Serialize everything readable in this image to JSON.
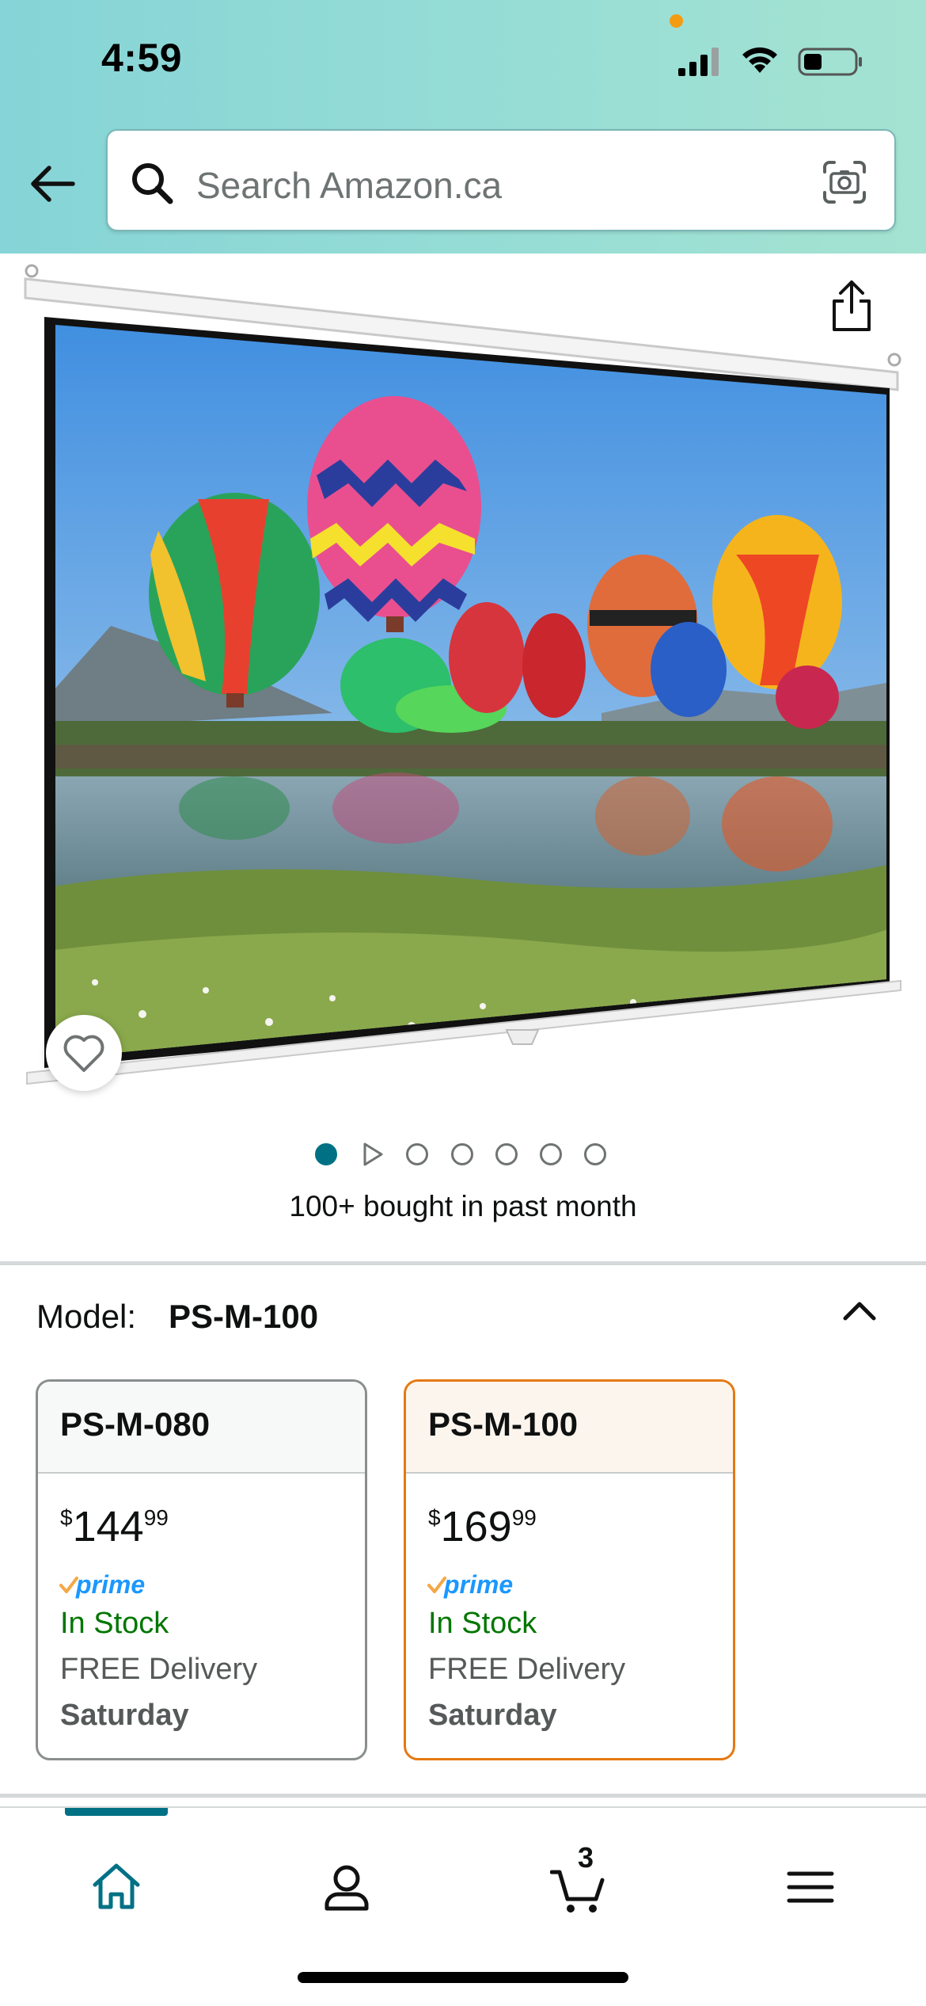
{
  "status_bar": {
    "time": "4:59"
  },
  "header": {
    "search": {
      "placeholder": "Search Amazon.ca"
    }
  },
  "product_image": {
    "subject": "projector-screen-hot-air-balloons"
  },
  "carousel": {
    "dots_count": 7,
    "active_index": 0,
    "video_index": 1
  },
  "social_proof": {
    "text": "100+ bought in past month"
  },
  "model_selector": {
    "label": "Model:",
    "selected": "PS-M-100",
    "options": [
      {
        "name": "PS-M-080",
        "price": {
          "symbol": "$",
          "whole": "144",
          "fraction": "99"
        },
        "prime": "prime",
        "stock": "In Stock",
        "delivery": "FREE Delivery",
        "day": "Saturday",
        "selected": false
      },
      {
        "name": "PS-M-100",
        "price": {
          "symbol": "$",
          "whole": "169",
          "fraction": "99"
        },
        "prime": "prime",
        "stock": "In Stock",
        "delivery": "FREE Delivery",
        "day": "Saturday",
        "selected": true
      }
    ]
  },
  "bottom_nav": {
    "active": "home",
    "items": [
      "home-icon",
      "account-icon",
      "cart-icon",
      "menu-icon"
    ],
    "cart_count": "3"
  },
  "colors": {
    "accent_teal": "#007185",
    "selected_border": "#e47911",
    "in_stock": "#007600",
    "prime_blue": "#1a98ff"
  }
}
